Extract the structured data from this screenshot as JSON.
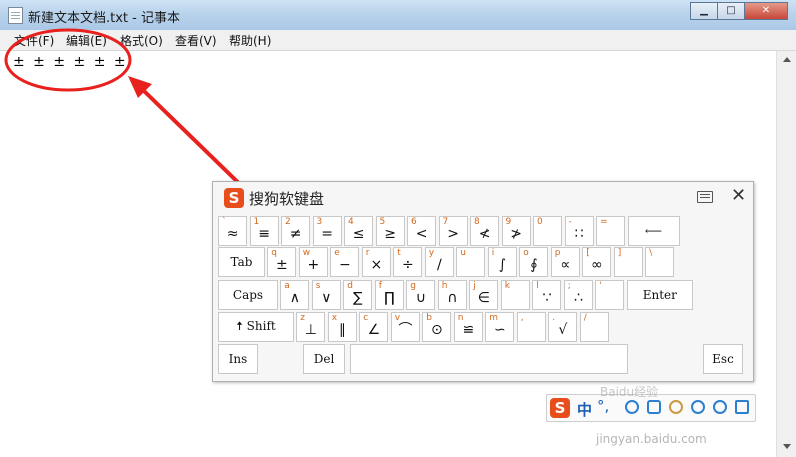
{
  "window": {
    "title": "新建文本文档.txt - 记事本",
    "min_label": "▁",
    "max_label": "□",
    "close_label": "✕"
  },
  "menu": [
    "文件(F)",
    "编辑(E)",
    "格式(O)",
    "查看(V)",
    "帮助(H)"
  ],
  "editor": {
    "content": "± ± ± ± ± ±"
  },
  "keyboard": {
    "logo": "S",
    "title": "搜狗软键盘",
    "close": "✕",
    "rows": [
      [
        {
          "shift": "`",
          "symbol": "≈"
        },
        {
          "shift": "1",
          "symbol": "≡"
        },
        {
          "shift": "2",
          "symbol": "≠"
        },
        {
          "shift": "3",
          "symbol": "="
        },
        {
          "shift": "4",
          "symbol": "≤"
        },
        {
          "shift": "5",
          "symbol": "≥"
        },
        {
          "shift": "6",
          "symbol": "<"
        },
        {
          "shift": "7",
          "symbol": ">"
        },
        {
          "shift": "8",
          "symbol": "≮"
        },
        {
          "shift": "9",
          "symbol": "≯"
        },
        {
          "shift": "0",
          "symbol": ""
        },
        {
          "shift": "-",
          "symbol": "∷"
        },
        {
          "shift": "=",
          "symbol": ""
        },
        {
          "label": "⟵"
        }
      ],
      [
        {
          "label": "Tab"
        },
        {
          "shift": "q",
          "symbol": "±"
        },
        {
          "shift": "w",
          "symbol": "+"
        },
        {
          "shift": "e",
          "symbol": "−"
        },
        {
          "shift": "r",
          "symbol": "×"
        },
        {
          "shift": "t",
          "symbol": "÷"
        },
        {
          "shift": "y",
          "symbol": "∕"
        },
        {
          "shift": "u",
          "symbol": ""
        },
        {
          "shift": "i",
          "symbol": "∫"
        },
        {
          "shift": "o",
          "symbol": "∮"
        },
        {
          "shift": "p",
          "symbol": "∝"
        },
        {
          "shift": "[",
          "symbol": "∞"
        },
        {
          "shift": "]",
          "symbol": ""
        },
        {
          "shift": "\\",
          "symbol": ""
        }
      ],
      [
        {
          "label": "Caps"
        },
        {
          "shift": "a",
          "symbol": "∧"
        },
        {
          "shift": "s",
          "symbol": "∨"
        },
        {
          "shift": "d",
          "symbol": "∑"
        },
        {
          "shift": "f",
          "symbol": "∏"
        },
        {
          "shift": "g",
          "symbol": "∪"
        },
        {
          "shift": "h",
          "symbol": "∩"
        },
        {
          "shift": "j",
          "symbol": "∈"
        },
        {
          "shift": "k",
          "symbol": ""
        },
        {
          "shift": "l",
          "symbol": "∵"
        },
        {
          "shift": ";",
          "symbol": "∴"
        },
        {
          "shift": "'",
          "symbol": ""
        },
        {
          "label": "Enter"
        }
      ],
      [
        {
          "label": "🠅 Shift"
        },
        {
          "shift": "z",
          "symbol": "⊥"
        },
        {
          "shift": "x",
          "symbol": "∥"
        },
        {
          "shift": "c",
          "symbol": "∠"
        },
        {
          "shift": "v",
          "symbol": "⌒"
        },
        {
          "shift": "b",
          "symbol": "⊙"
        },
        {
          "shift": "n",
          "symbol": "≌"
        },
        {
          "shift": "m",
          "symbol": "∽"
        },
        {
          "shift": ",",
          "symbol": ""
        },
        {
          "shift": ".",
          "symbol": "√"
        },
        {
          "shift": "/",
          "symbol": ""
        }
      ],
      [
        {
          "label": "Ins"
        },
        {
          "label": "Del"
        },
        {
          "label": ""
        },
        {
          "label": "Esc"
        }
      ]
    ]
  },
  "ime": {
    "logo": "S",
    "mode": "中",
    "punct": "°,"
  },
  "watermark": {
    "line1": "Baidu经验",
    "line2": "jingyan.baidu.com"
  }
}
